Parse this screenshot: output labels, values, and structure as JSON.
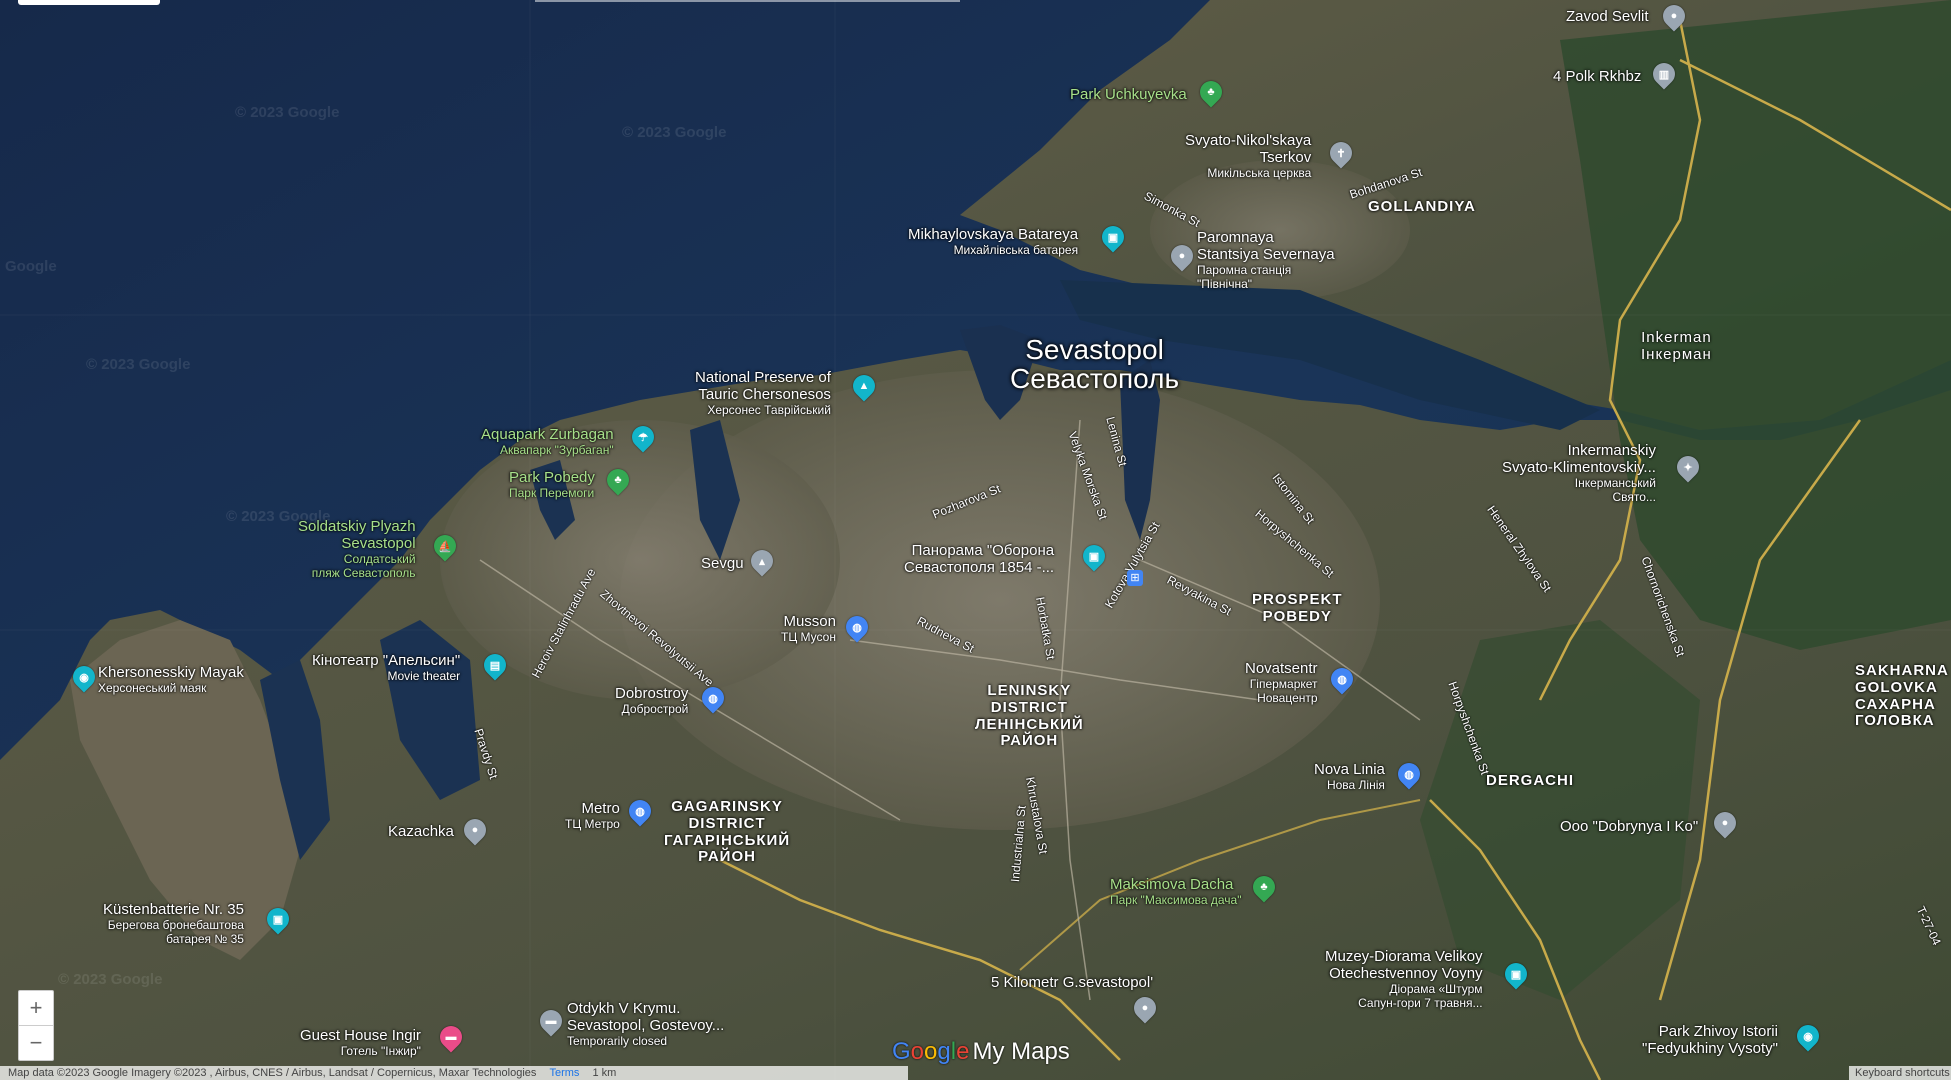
{
  "city": {
    "name_en": "Sevastopol",
    "name_ru": "Севастополь"
  },
  "districts": [
    {
      "id": "gollandiya",
      "lines": [
        "GOLLANDIYA"
      ]
    },
    {
      "id": "prospekt-pobedy",
      "lines": [
        "PROSPEKT",
        "POBEDY"
      ]
    },
    {
      "id": "leninsky",
      "lines": [
        "LENINSKY",
        "DISTRICT",
        "ЛЕНІНСЬКИЙ",
        "РАЙОН"
      ]
    },
    {
      "id": "gagarinsky",
      "lines": [
        "GAGARINSKY",
        "DISTRICT",
        "ГАГАРІНСЬКИЙ",
        "РАЙОН"
      ]
    },
    {
      "id": "dergachi",
      "lines": [
        "DERGACHI"
      ]
    },
    {
      "id": "sakharna",
      "lines": [
        "SAKHARNA",
        "GOLOVKA",
        "САХАРНА",
        "ГОЛОВКА"
      ]
    },
    {
      "id": "inkerman",
      "lines": [
        "Inkerman",
        "Інкерман"
      ]
    }
  ],
  "pois": [
    {
      "id": "zavod-sevlit",
      "t": "Zavod Sevlit",
      "s": "",
      "color": "#9aa6b2",
      "glyph": "●"
    },
    {
      "id": "4-polk",
      "t": "4 Polk Rkhbz",
      "s": "",
      "color": "#9aa6b2",
      "glyph": "▥"
    },
    {
      "id": "park-uchkuyevka",
      "t": "Park Uchkuyevka",
      "s": "",
      "color": "#34a853",
      "glyph": "♣"
    },
    {
      "id": "svyato-nikolskaya",
      "t": "Svyato-Nikol'skaya",
      "t2": "Tserkov",
      "s": "Микільська церква",
      "color": "#9aa6b2",
      "glyph": "✝"
    },
    {
      "id": "mikhaylovskaya",
      "t": "Mikhaylovskaya Batareya",
      "s": "Михайлівська батарея",
      "color": "#12b5cb",
      "glyph": "▣"
    },
    {
      "id": "paromnaya",
      "t": "Paromnaya",
      "t2": "Stantsiya Severnaya",
      "s": "Паромна станція",
      "s2": "\"Північна\"",
      "color": "#9aa6b2",
      "glyph": "●"
    },
    {
      "id": "tauric",
      "t": "National Preserve of",
      "t2": "Tauric Chersonesos",
      "s": "Херсонес Таврійський",
      "color": "#12b5cb",
      "glyph": "▲"
    },
    {
      "id": "aquapark",
      "t": "Aquapark Zurbagan",
      "s": "Аквапарк \"Зурбаган\"",
      "color": "#12b5cb",
      "glyph": "☂"
    },
    {
      "id": "park-pobedy",
      "t": "Park Pobedy",
      "s": "Парк Перемоги",
      "color": "#34a853",
      "glyph": "♣"
    },
    {
      "id": "soldatskiy",
      "t": "Soldatskiy Plyazh",
      "t2": "Sevastopol",
      "s": "Солдатський",
      "s2": "пляж Севастополь",
      "color": "#34a853",
      "glyph": "⛵"
    },
    {
      "id": "sevgu",
      "t": "Sevgu",
      "s": "",
      "color": "#9aa6b2",
      "glyph": "▴"
    },
    {
      "id": "panorama",
      "t": "Панорама \"Оборона",
      "t2": "Севастополя 1854 -...",
      "s": "",
      "color": "#12b5cb",
      "glyph": "▣"
    },
    {
      "id": "musson",
      "t": "Musson",
      "s": "ТЦ Мусон",
      "color": "#4285f4",
      "glyph": "◍"
    },
    {
      "id": "khersonesskiy",
      "t": "Khersonesskiy Mayak",
      "s": "Херсонеський маяк",
      "color": "#12b5cb",
      "glyph": "◉"
    },
    {
      "id": "kinoteatr",
      "t": "Кінотеатр \"Апельсин\"",
      "s": "Movie theater",
      "color": "#12b5cb",
      "glyph": "▤"
    },
    {
      "id": "dobrostroy",
      "t": "Dobrostroy",
      "s": "Добрострой",
      "color": "#4285f4",
      "glyph": "◍"
    },
    {
      "id": "novatsentr",
      "t": "Novatsentr",
      "s": "Гіпермаркет",
      "s2": "Новацентр",
      "color": "#4285f4",
      "glyph": "◍"
    },
    {
      "id": "nova-linia",
      "t": "Nova Linia",
      "s": "Нова Лінія",
      "color": "#4285f4",
      "glyph": "◍"
    },
    {
      "id": "metro",
      "t": "Metro",
      "s": "ТЦ Метро",
      "color": "#4285f4",
      "glyph": "◍"
    },
    {
      "id": "kazachka",
      "t": "Kazachka",
      "s": "",
      "color": "#9aa6b2",
      "glyph": "●"
    },
    {
      "id": "kustenbatterie",
      "t": "Küstenbatterie Nr. 35",
      "s": "Берегова бронебаштова",
      "s2": "батарея № 35",
      "color": "#12b5cb",
      "glyph": "▣"
    },
    {
      "id": "maksimova",
      "t": "Maksimova Dacha",
      "s": "Парк \"Максимова дача\"",
      "color": "#34a853",
      "glyph": "♣"
    },
    {
      "id": "muzey",
      "t": "Muzey-Diorama Velikoy",
      "t2": "Otechestvennoy Voyny",
      "s": "Діорама «Штурм",
      "s2": "Сапун-гори 7 травня...",
      "color": "#12b5cb",
      "glyph": "▣"
    },
    {
      "id": "5km",
      "t": "5 Kilometr G.sevastopol'",
      "s": "",
      "color": "#9aa6b2",
      "glyph": "●"
    },
    {
      "id": "otdykh",
      "t": "Otdykh V Krymu.",
      "t2": "Sevastopol, Gostevoy...",
      "s": "Temporarily closed",
      "color": "#9aa6b2",
      "glyph": "▬"
    },
    {
      "id": "guest-house",
      "t": "Guest House Ingir",
      "s": "Готель \"Інжир\"",
      "color": "#ea4c89",
      "glyph": "▬"
    },
    {
      "id": "inkermanskiy",
      "t": "Inkermanskiy",
      "t2": "Svyato-Klimentovskiy...",
      "s": "Інкерманський",
      "s2": "Свято...",
      "color": "#9aa6b2",
      "glyph": "✦"
    },
    {
      "id": "dobrynya",
      "t": "Ooo \"Dobrynya I Ko\"",
      "s": "",
      "color": "#9aa6b2",
      "glyph": "●"
    },
    {
      "id": "park-zhivoy",
      "t": "Park Zhivoy Istorii",
      "t2": "\"Fedyukhiny Vysoty\"",
      "s": "",
      "color": "#12b5cb",
      "glyph": "◉"
    }
  ],
  "streets": [
    "Simonka St",
    "Bohdanova St",
    "Pozharova St",
    "Velyka Morska St",
    "Lenina St",
    "Istomina St",
    "Horpyshchenka St",
    "Heneral Zhylovа St",
    "Revyakina St",
    "Rudneva St",
    "Chornorichenska St",
    "Kotova Vulytsia St",
    "Horbatka St",
    "Herоiv Stalinhradu Ave",
    "Zhovtnevoi Revolyutsii Ave",
    "Pravdy St",
    "Khrustalova St",
    "Industrialna St",
    "Horpyshchenka St",
    "T-27-04"
  ],
  "watermarks": [
    "© 2023 Google",
    "© 2023 Google",
    "Google",
    "© 2023 Google",
    "© 2023 Google",
    "© 2023 Google"
  ],
  "zoom": {
    "in": "+",
    "out": "−"
  },
  "footer": {
    "attribution": "Map data ©2023 Google Imagery ©2023 , Airbus, CNES / Airbus, Landsat / Copernicus, Maxar Technologies",
    "terms": "Terms",
    "scale": "1 km"
  },
  "logo": {
    "google": [
      "G",
      "o",
      "o",
      "g",
      "l",
      "e"
    ],
    "product": "My Maps"
  },
  "bottom_right_stub": "Keyboard shortcuts"
}
